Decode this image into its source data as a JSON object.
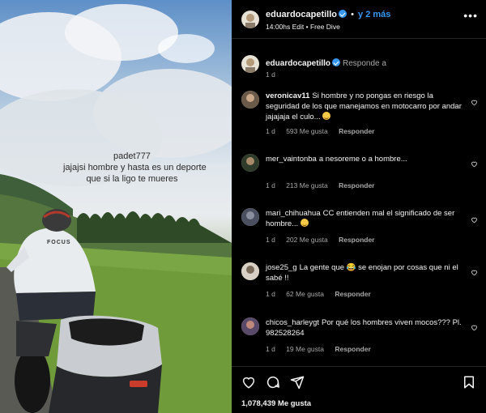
{
  "photo": {
    "overlay_lines": [
      "padet777",
      "jajajsi hombre y hasta es un deporte",
      "que si la ligo te mueres"
    ],
    "jacket_text": "FOCUS"
  },
  "post": {
    "username": "eduardocapetillo",
    "separator": "•",
    "follow_label": "y 2 más",
    "subtitle": "14:00hs Edit • Free Dive",
    "more_icon": "more-horizontal-icon",
    "verified_color": "#3897f0"
  },
  "owner_comment": {
    "username": "eduardocapetillo",
    "text": "Responde a",
    "time": "1 d"
  },
  "comments": [
    {
      "username": "veronicav11",
      "text": "Si hombre y no pongas en riesgo la seguridad de los que manejamos en motocarro por andar jajajaja el culo...",
      "emoji": true,
      "time": "1 d",
      "likes": "593 Me gusta",
      "reply": "Responder"
    },
    {
      "username": "mer_vaintonba",
      "text": "a nesoreme o a hombre...",
      "emoji": false,
      "time": "1 d",
      "likes": "213 Me gusta",
      "reply": "Responder"
    },
    {
      "username": "mari_chihuahua",
      "text": "CC entienden mal el significado de ser hombre...",
      "emoji": true,
      "time": "1 d",
      "likes": "202 Me gusta",
      "reply": "Responder"
    },
    {
      "username": "jose25_g",
      "text": "La gente que 😂 se enojan por cosas que ni el sabé !!",
      "emoji": false,
      "time": "1 d",
      "likes": "62 Me gusta",
      "reply": "Responder"
    },
    {
      "username": "chicos_harleygt",
      "text": "Por qué los hombres viven mocos??? Pl. 982528264",
      "emoji": false,
      "time": "1 d",
      "likes": "19 Me gusta",
      "reply": "Responder"
    }
  ],
  "actions": {
    "icons": [
      "heart-icon",
      "comment-icon",
      "share-icon",
      "bookmark-icon"
    ],
    "likes": "1,078,439 Me gusta"
  }
}
